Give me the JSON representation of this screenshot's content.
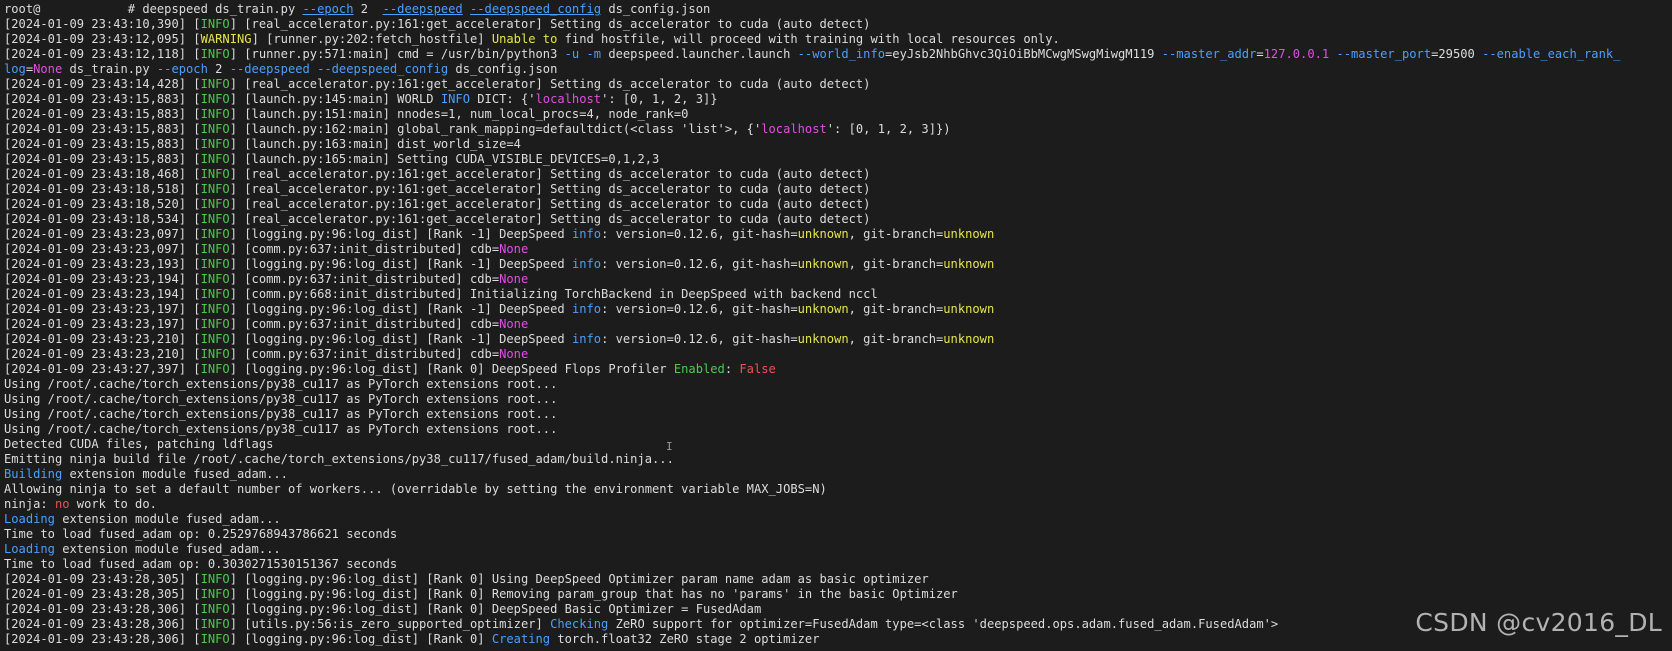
{
  "terminal": {
    "lines": [
      [
        {
          "t": "root@",
          "c": "white"
        },
        {
          "t": "            ",
          "c": "dim"
        },
        {
          "t": "# deepspeed ds_train.py ",
          "c": "white"
        },
        {
          "t": "--epoch",
          "c": "blue",
          "u": true
        },
        {
          "t": " 2  ",
          "c": "white"
        },
        {
          "t": "--deepspeed",
          "c": "blue",
          "u": true
        },
        {
          "t": " ",
          "c": "white"
        },
        {
          "t": "--deepspeed_config",
          "c": "blue",
          "u": true
        },
        {
          "t": " ds_config.json",
          "c": "white"
        }
      ],
      [
        {
          "t": "[2024-01-09 23:43:10,390] [",
          "c": "white"
        },
        {
          "t": "INFO",
          "c": "green"
        },
        {
          "t": "] [real_accelerator.py:161:get_accelerator] Setting ds_accelerator to cuda (auto detect)",
          "c": "white"
        }
      ],
      [
        {
          "t": "[2024-01-09 23:43:12,095] [",
          "c": "white"
        },
        {
          "t": "WARNING",
          "c": "yellow"
        },
        {
          "t": "] [runner.py:202:fetch_hostfile] ",
          "c": "white"
        },
        {
          "t": "Unable to",
          "c": "yellow"
        },
        {
          "t": " find hostfile, will proceed with training with local resources only.",
          "c": "white"
        }
      ],
      [
        {
          "t": "[2024-01-09 23:43:12,118] [",
          "c": "white"
        },
        {
          "t": "INFO",
          "c": "green"
        },
        {
          "t": "] [runner.py:571:main] cmd = /usr/bin/python3 ",
          "c": "white"
        },
        {
          "t": "-u",
          "c": "blue"
        },
        {
          "t": " ",
          "c": "white"
        },
        {
          "t": "-m",
          "c": "blue"
        },
        {
          "t": " deepspeed.launcher.launch ",
          "c": "white"
        },
        {
          "t": "--world_info",
          "c": "blue"
        },
        {
          "t": "=eyJsb2NhbGhvc3QiOiBbMCwgMSwgMiwgM119 ",
          "c": "white"
        },
        {
          "t": "--master_addr",
          "c": "blue"
        },
        {
          "t": "=",
          "c": "white"
        },
        {
          "t": "127.0.0.1",
          "c": "magenta"
        },
        {
          "t": " ",
          "c": "white"
        },
        {
          "t": "--master_port",
          "c": "blue"
        },
        {
          "t": "=29500 ",
          "c": "white"
        },
        {
          "t": "--enable_each_rank_",
          "c": "blue"
        }
      ],
      [
        {
          "t": "log",
          "c": "blue"
        },
        {
          "t": "=",
          "c": "white"
        },
        {
          "t": "None",
          "c": "magenta"
        },
        {
          "t": " ds_train.py ",
          "c": "white"
        },
        {
          "t": "--epoch",
          "c": "blue"
        },
        {
          "t": " 2 ",
          "c": "white"
        },
        {
          "t": "--deepspeed",
          "c": "blue"
        },
        {
          "t": " ",
          "c": "white"
        },
        {
          "t": "--deepspeed_config",
          "c": "blue"
        },
        {
          "t": " ds_config.json",
          "c": "white"
        }
      ],
      [
        {
          "t": "[2024-01-09 23:43:14,428] [",
          "c": "white"
        },
        {
          "t": "INFO",
          "c": "green"
        },
        {
          "t": "] [real_accelerator.py:161:get_accelerator] Setting ds_accelerator to cuda (auto detect)",
          "c": "white"
        }
      ],
      [
        {
          "t": "[2024-01-09 23:43:15,883] [",
          "c": "white"
        },
        {
          "t": "INFO",
          "c": "green"
        },
        {
          "t": "] [launch.py:145:main] WORLD ",
          "c": "white"
        },
        {
          "t": "INFO",
          "c": "blue"
        },
        {
          "t": " DICT: {'",
          "c": "white"
        },
        {
          "t": "localhost",
          "c": "magenta"
        },
        {
          "t": "': [0, 1, 2, 3]}",
          "c": "white"
        }
      ],
      [
        {
          "t": "[2024-01-09 23:43:15,883] [",
          "c": "white"
        },
        {
          "t": "INFO",
          "c": "green"
        },
        {
          "t": "] [launch.py:151:main] nnodes=1, num_local_procs=4, node_rank=0",
          "c": "white"
        }
      ],
      [
        {
          "t": "[2024-01-09 23:43:15,883] [",
          "c": "white"
        },
        {
          "t": "INFO",
          "c": "green"
        },
        {
          "t": "] [launch.py:162:main] global_rank_mapping=defaultdict(<class 'list'>, {'",
          "c": "white"
        },
        {
          "t": "localhost",
          "c": "magenta"
        },
        {
          "t": "': [0, 1, 2, 3]})",
          "c": "white"
        }
      ],
      [
        {
          "t": "[2024-01-09 23:43:15,883] [",
          "c": "white"
        },
        {
          "t": "INFO",
          "c": "green"
        },
        {
          "t": "] [launch.py:163:main] dist_world_size=4",
          "c": "white"
        }
      ],
      [
        {
          "t": "[2024-01-09 23:43:15,883] [",
          "c": "white"
        },
        {
          "t": "INFO",
          "c": "green"
        },
        {
          "t": "] [launch.py:165:main] Setting CUDA_VISIBLE_DEVICES=0,1,2,3",
          "c": "white"
        }
      ],
      [
        {
          "t": "[2024-01-09 23:43:18,468] [",
          "c": "white"
        },
        {
          "t": "INFO",
          "c": "green"
        },
        {
          "t": "] [real_accelerator.py:161:get_accelerator] Setting ds_accelerator to cuda (auto detect)",
          "c": "white"
        }
      ],
      [
        {
          "t": "[2024-01-09 23:43:18,518] [",
          "c": "white"
        },
        {
          "t": "INFO",
          "c": "green"
        },
        {
          "t": "] [real_accelerator.py:161:get_accelerator] Setting ds_accelerator to cuda (auto detect)",
          "c": "white"
        }
      ],
      [
        {
          "t": "[2024-01-09 23:43:18,520] [",
          "c": "white"
        },
        {
          "t": "INFO",
          "c": "green"
        },
        {
          "t": "] [real_accelerator.py:161:get_accelerator] Setting ds_accelerator to cuda (auto detect)",
          "c": "white"
        }
      ],
      [
        {
          "t": "[2024-01-09 23:43:18,534] [",
          "c": "white"
        },
        {
          "t": "INFO",
          "c": "green"
        },
        {
          "t": "] [real_accelerator.py:161:get_accelerator] Setting ds_accelerator to cuda (auto detect)",
          "c": "white"
        }
      ],
      [
        {
          "t": "[2024-01-09 23:43:23,097] [",
          "c": "white"
        },
        {
          "t": "INFO",
          "c": "green"
        },
        {
          "t": "] [logging.py:96:log_dist] [Rank -1] DeepSpeed ",
          "c": "white"
        },
        {
          "t": "info",
          "c": "blue"
        },
        {
          "t": ": version=0.12.6, git-hash=",
          "c": "white"
        },
        {
          "t": "unknown",
          "c": "yellow"
        },
        {
          "t": ", git-branch=",
          "c": "white"
        },
        {
          "t": "unknown",
          "c": "yellow"
        }
      ],
      [
        {
          "t": "[2024-01-09 23:43:23,097] [",
          "c": "white"
        },
        {
          "t": "INFO",
          "c": "green"
        },
        {
          "t": "] [comm.py:637:init_distributed] cdb=",
          "c": "white"
        },
        {
          "t": "None",
          "c": "magenta"
        }
      ],
      [
        {
          "t": "[2024-01-09 23:43:23,193] [",
          "c": "white"
        },
        {
          "t": "INFO",
          "c": "green"
        },
        {
          "t": "] [logging.py:96:log_dist] [Rank -1] DeepSpeed ",
          "c": "white"
        },
        {
          "t": "info",
          "c": "blue"
        },
        {
          "t": ": version=0.12.6, git-hash=",
          "c": "white"
        },
        {
          "t": "unknown",
          "c": "yellow"
        },
        {
          "t": ", git-branch=",
          "c": "white"
        },
        {
          "t": "unknown",
          "c": "yellow"
        }
      ],
      [
        {
          "t": "[2024-01-09 23:43:23,194] [",
          "c": "white"
        },
        {
          "t": "INFO",
          "c": "green"
        },
        {
          "t": "] [comm.py:637:init_distributed] cdb=",
          "c": "white"
        },
        {
          "t": "None",
          "c": "magenta"
        }
      ],
      [
        {
          "t": "[2024-01-09 23:43:23,194] [",
          "c": "white"
        },
        {
          "t": "INFO",
          "c": "green"
        },
        {
          "t": "] [comm.py:668:init_distributed] Initializing TorchBackend in DeepSpeed with backend nccl",
          "c": "white"
        }
      ],
      [
        {
          "t": "[2024-01-09 23:43:23,197] [",
          "c": "white"
        },
        {
          "t": "INFO",
          "c": "green"
        },
        {
          "t": "] [logging.py:96:log_dist] [Rank -1] DeepSpeed ",
          "c": "white"
        },
        {
          "t": "info",
          "c": "blue"
        },
        {
          "t": ": version=0.12.6, git-hash=",
          "c": "white"
        },
        {
          "t": "unknown",
          "c": "yellow"
        },
        {
          "t": ", git-branch=",
          "c": "white"
        },
        {
          "t": "unknown",
          "c": "yellow"
        }
      ],
      [
        {
          "t": "[2024-01-09 23:43:23,197] [",
          "c": "white"
        },
        {
          "t": "INFO",
          "c": "green"
        },
        {
          "t": "] [comm.py:637:init_distributed] cdb=",
          "c": "white"
        },
        {
          "t": "None",
          "c": "magenta"
        }
      ],
      [
        {
          "t": "[2024-01-09 23:43:23,210] [",
          "c": "white"
        },
        {
          "t": "INFO",
          "c": "green"
        },
        {
          "t": "] [logging.py:96:log_dist] [Rank -1] DeepSpeed ",
          "c": "white"
        },
        {
          "t": "info",
          "c": "blue"
        },
        {
          "t": ": version=0.12.6, git-hash=",
          "c": "white"
        },
        {
          "t": "unknown",
          "c": "yellow"
        },
        {
          "t": ", git-branch=",
          "c": "white"
        },
        {
          "t": "unknown",
          "c": "yellow"
        }
      ],
      [
        {
          "t": "[2024-01-09 23:43:23,210] [",
          "c": "white"
        },
        {
          "t": "INFO",
          "c": "green"
        },
        {
          "t": "] [comm.py:637:init_distributed] cdb=",
          "c": "white"
        },
        {
          "t": "None",
          "c": "magenta"
        }
      ],
      [
        {
          "t": "[2024-01-09 23:43:27,397] [",
          "c": "white"
        },
        {
          "t": "INFO",
          "c": "green"
        },
        {
          "t": "] [logging.py:96:log_dist] [Rank 0] DeepSpeed Flops Profiler ",
          "c": "white"
        },
        {
          "t": "Enabled",
          "c": "green"
        },
        {
          "t": ": ",
          "c": "white"
        },
        {
          "t": "False",
          "c": "red"
        }
      ],
      [
        {
          "t": "Using /root/.cache/torch_extensions/py38_cu117 as PyTorch extensions root...",
          "c": "white"
        }
      ],
      [
        {
          "t": "Using /root/.cache/torch_extensions/py38_cu117 as PyTorch extensions root...",
          "c": "white"
        }
      ],
      [
        {
          "t": "Using /root/.cache/torch_extensions/py38_cu117 as PyTorch extensions root...",
          "c": "white"
        }
      ],
      [
        {
          "t": "Using /root/.cache/torch_extensions/py38_cu117 as PyTorch extensions root...",
          "c": "white"
        }
      ],
      [
        {
          "t": "Detected CUDA files, patching ldflags",
          "c": "white"
        }
      ],
      [
        {
          "t": "Emitting ninja build file /root/.cache/torch_extensions/py38_cu117/fused_adam/build.ninja...",
          "c": "white"
        }
      ],
      [
        {
          "t": "Building",
          "c": "blue"
        },
        {
          "t": " extension module fused_adam...",
          "c": "white"
        }
      ],
      [
        {
          "t": "Allowing ninja to set a default number of workers... (overridable by setting the environment variable MAX_JOBS=N)",
          "c": "white"
        }
      ],
      [
        {
          "t": "ninja: ",
          "c": "white"
        },
        {
          "t": "no",
          "c": "red"
        },
        {
          "t": " work to do.",
          "c": "white"
        }
      ],
      [
        {
          "t": "Loading",
          "c": "blue"
        },
        {
          "t": " extension module fused_adam...",
          "c": "white"
        }
      ],
      [
        {
          "t": "Time to load fused_adam op: 0.2529768943786621 seconds",
          "c": "white"
        }
      ],
      [
        {
          "t": "Loading",
          "c": "blue"
        },
        {
          "t": " extension module fused_adam...",
          "c": "white"
        }
      ],
      [
        {
          "t": "Time to load fused_adam op: 0.3030271530151367 seconds",
          "c": "white"
        }
      ],
      [
        {
          "t": "[2024-01-09 23:43:28,305] [",
          "c": "white"
        },
        {
          "t": "INFO",
          "c": "green"
        },
        {
          "t": "] [logging.py:96:log_dist] [Rank 0] Using DeepSpeed Optimizer param name adam as basic optimizer",
          "c": "white"
        }
      ],
      [
        {
          "t": "[2024-01-09 23:43:28,305] [",
          "c": "white"
        },
        {
          "t": "INFO",
          "c": "green"
        },
        {
          "t": "] [logging.py:96:log_dist] [Rank 0] Removing param_group that has no 'params' in the basic Optimizer",
          "c": "white"
        }
      ],
      [
        {
          "t": "[2024-01-09 23:43:28,306] [",
          "c": "white"
        },
        {
          "t": "INFO",
          "c": "green"
        },
        {
          "t": "] [logging.py:96:log_dist] [Rank 0] DeepSpeed Basic Optimizer = FusedAdam",
          "c": "white"
        }
      ],
      [
        {
          "t": "[2024-01-09 23:43:28,306] [",
          "c": "white"
        },
        {
          "t": "INFO",
          "c": "green"
        },
        {
          "t": "] [utils.py:56:is_zero_supported_optimizer] ",
          "c": "white"
        },
        {
          "t": "Checking",
          "c": "blue"
        },
        {
          "t": " ZeRO support for optimizer=FusedAdam type=<class 'deepspeed.ops.adam.fused_adam.FusedAdam'>",
          "c": "white"
        }
      ],
      [
        {
          "t": "[2024-01-09 23:43:28,306] [",
          "c": "white"
        },
        {
          "t": "INFO",
          "c": "green"
        },
        {
          "t": "] [logging.py:96:log_dist] [Rank 0] ",
          "c": "white"
        },
        {
          "t": "Creating",
          "c": "blue"
        },
        {
          "t": " torch.float32 ZeRO stage 2 optimizer",
          "c": "white"
        }
      ]
    ]
  },
  "cursor": {
    "glyph": "I"
  },
  "watermark": {
    "text": "CSDN @cv2016_DL"
  },
  "colors": {
    "background": "#1c1c1c",
    "text": "#dcdcdc",
    "green": "#4ec94e",
    "yellow": "#e5e54b",
    "magenta": "#e04fe0",
    "blue": "#4a9fff",
    "red": "#f05050"
  }
}
